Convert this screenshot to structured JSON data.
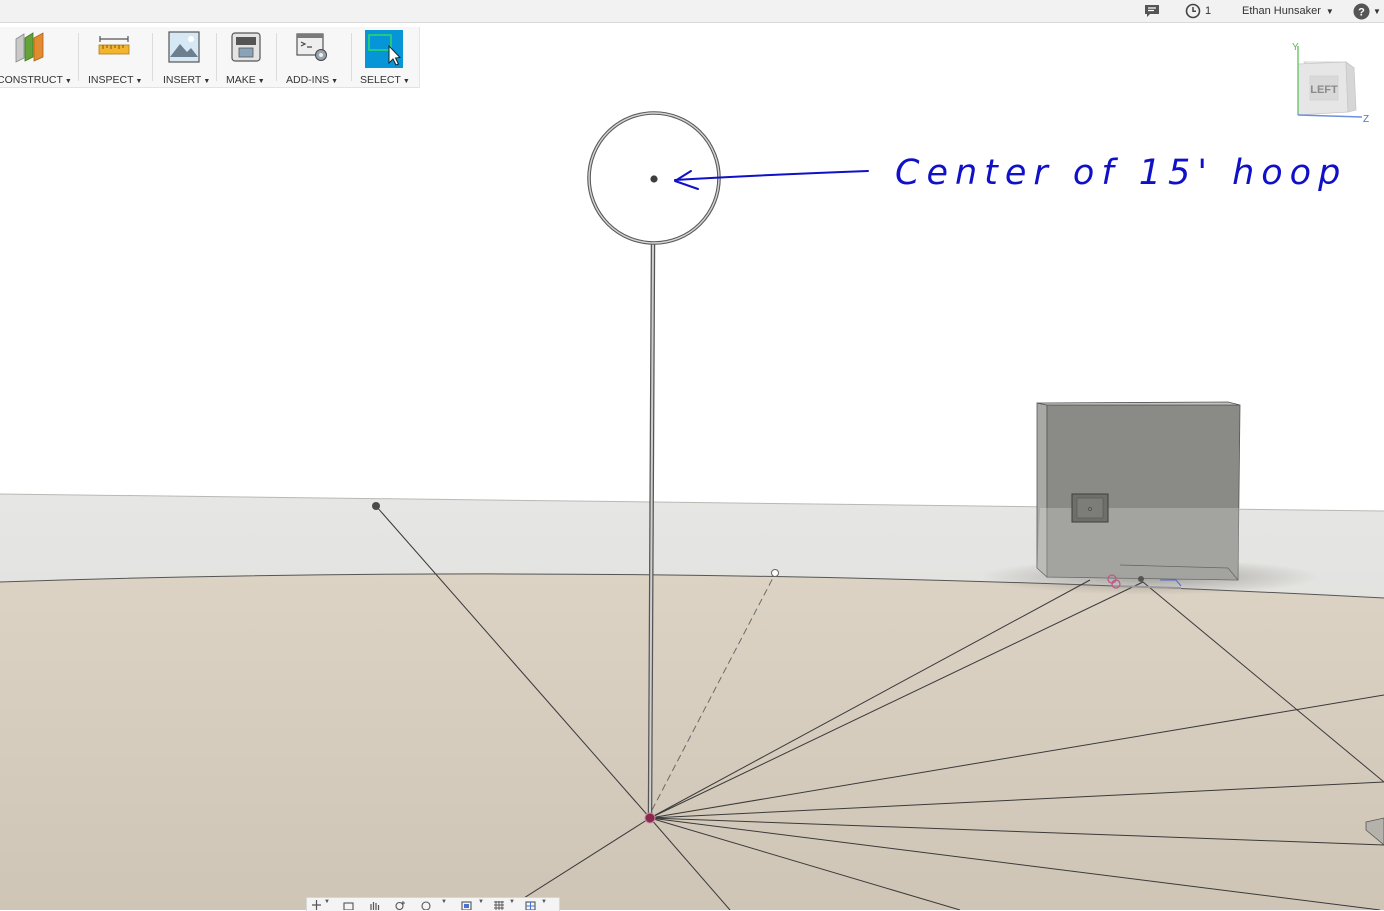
{
  "topbar": {
    "notifications_icon": "comment-icon",
    "jobs_icon": "clock-icon",
    "jobs_count": "1",
    "user_name": "Ethan Hunsaker",
    "help_icon": "help-icon"
  },
  "ribbon": {
    "groups": [
      {
        "label": "CONSTRUCT",
        "icon": "construct-plane-icon"
      },
      {
        "label": "INSPECT",
        "icon": "measure-ruler-icon"
      },
      {
        "label": "INSERT",
        "icon": "insert-image-icon"
      },
      {
        "label": "MAKE",
        "icon": "make-3d-print-icon"
      },
      {
        "label": "ADD-INS",
        "icon": "scripts-addins-icon"
      },
      {
        "label": "SELECT",
        "icon": "select-window-icon",
        "active": true
      }
    ]
  },
  "viewcube": {
    "face_label": "LEFT",
    "axis_y": "Y",
    "axis_z": "Z"
  },
  "annotation": {
    "text": "Center of 15' hoop"
  },
  "colors": {
    "accent": "#0696d7",
    "annotation_ink": "#1010c8",
    "ground": "#d6cbbb",
    "sketch_point": "#8a2a4a"
  },
  "navbar": {
    "icons": [
      "orbit-icon",
      "look-at-icon",
      "pan-icon",
      "zoom-icon",
      "fit-icon",
      "display-settings-icon",
      "grid-settings-icon",
      "viewports-icon"
    ]
  }
}
